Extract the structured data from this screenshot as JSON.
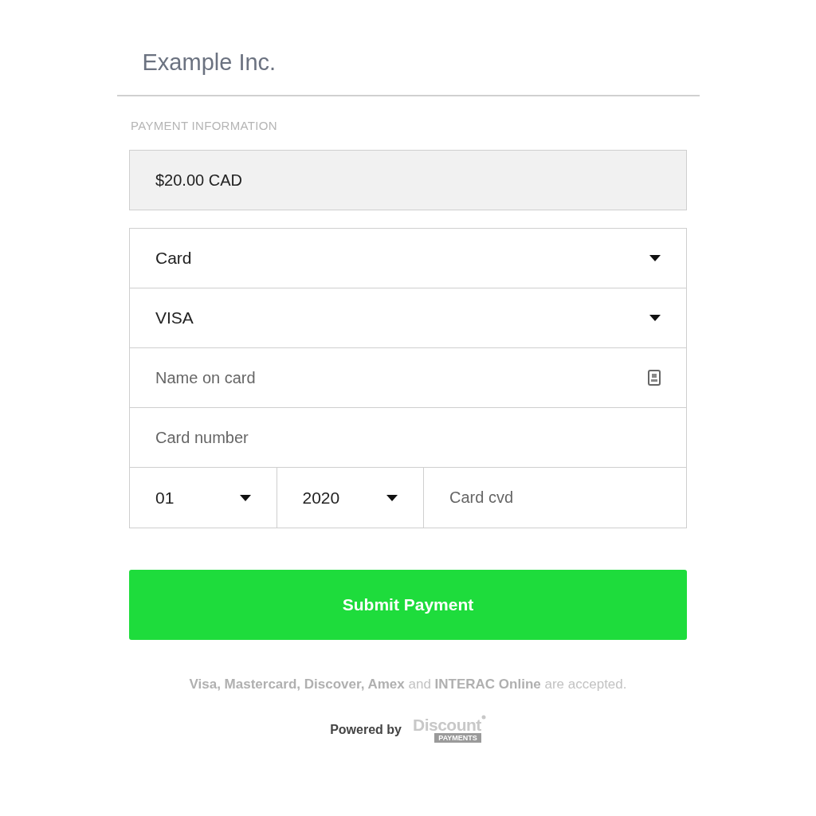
{
  "merchant": {
    "name": "Example Inc."
  },
  "section_label": "PAYMENT INFORMATION",
  "amount": "$20.00 CAD",
  "fields": [
    {
      "kind": "select",
      "value": "Card"
    },
    {
      "kind": "select",
      "value": "VISA"
    },
    {
      "kind": "name",
      "placeholder": "Name on card"
    },
    {
      "kind": "text",
      "placeholder": "Card number"
    }
  ],
  "expiry": {
    "month": "01",
    "year": "2020",
    "cvd_placeholder": "Card cvd"
  },
  "submit": "Submit Payment",
  "accepted": "**Visa, Mastercard, Discover, Amex** and **INTERAC Online** are accepted.",
  "powered_by": "Powered by",
  "logo": {
    "name": "Discount",
    "tag": "PAYMENTS"
  }
}
